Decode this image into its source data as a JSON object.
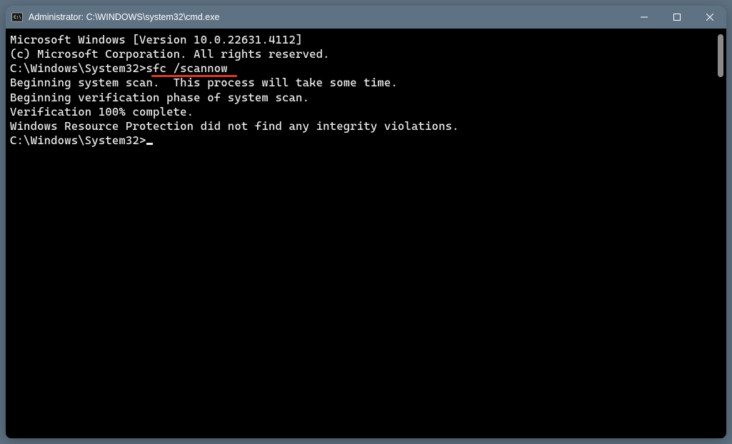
{
  "titlebar": {
    "title": "Administrator: C:\\WINDOWS\\system32\\cmd.exe",
    "icon_name": "cmd-icon"
  },
  "terminal": {
    "lines": {
      "l0": "Microsoft Windows [Version 10.0.22631.4112]",
      "l1": "(c) Microsoft Corporation. All rights reserved.",
      "blank": "",
      "prompt1_prefix": "C:\\Windows\\System32>",
      "prompt1_cmd": "sfc /scannow",
      "l3": "Beginning system scan.  This process will take some time.",
      "l4": "Beginning verification phase of system scan.",
      "l5": "Verification 100% complete.",
      "l6": "Windows Resource Protection did not find any integrity violations.",
      "prompt2": "C:\\Windows\\System32>"
    }
  }
}
